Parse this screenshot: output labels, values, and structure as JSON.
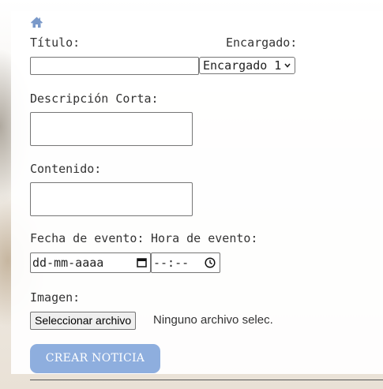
{
  "nav": {
    "home_icon": "home-icon",
    "icon_color": "#7a99c9"
  },
  "form": {
    "titulo_label": "Título:",
    "titulo_value": "",
    "encargado_label": "Encargado:",
    "encargado_selected": "Encargado 1",
    "descripcion_label": "Descripción Corta:",
    "descripcion_value": "",
    "contenido_label": "Contenido:",
    "contenido_value": "",
    "fecha_label": "Fecha de evento:",
    "fecha_placeholder": "dd-mm-aaaa",
    "hora_label": "Hora de evento:",
    "hora_placeholder": "--:--",
    "imagen_label": "Imagen:",
    "file_button_label": "Seleccionar archivo",
    "file_status": "Ninguno archivo selec.",
    "submit_label": "CREAR NOTICIA"
  },
  "colors": {
    "submit_bg": "#8eaede",
    "submit_text": "#ffffff",
    "text": "#333333"
  }
}
